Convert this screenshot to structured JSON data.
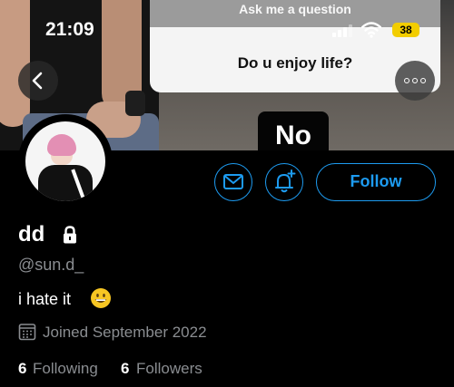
{
  "status_bar": {
    "time": "21:09",
    "battery": "38"
  },
  "banner": {
    "question_title": "Ask me a question",
    "question_text": "Do u enjoy life?",
    "answer": "No"
  },
  "profile": {
    "name": "dd",
    "handle": "@sun.d_",
    "bio": "i hate it",
    "joined": "Joined September 2022",
    "following_count": "6",
    "following_label": "Following",
    "followers_count": "6",
    "followers_label": "Followers"
  },
  "actions": {
    "follow_label": "Follow"
  },
  "icons": {
    "back": "chevron-left-icon",
    "more": "more-icon",
    "message": "mail-icon",
    "notify": "bell-plus-icon",
    "lock": "lock-icon",
    "calendar": "calendar-icon",
    "emoji": "grinning-face-icon"
  },
  "colors": {
    "accent": "#1d9bf0",
    "background": "#000000",
    "secondary_text": "#8a8d91",
    "battery": "#f2cd00"
  }
}
